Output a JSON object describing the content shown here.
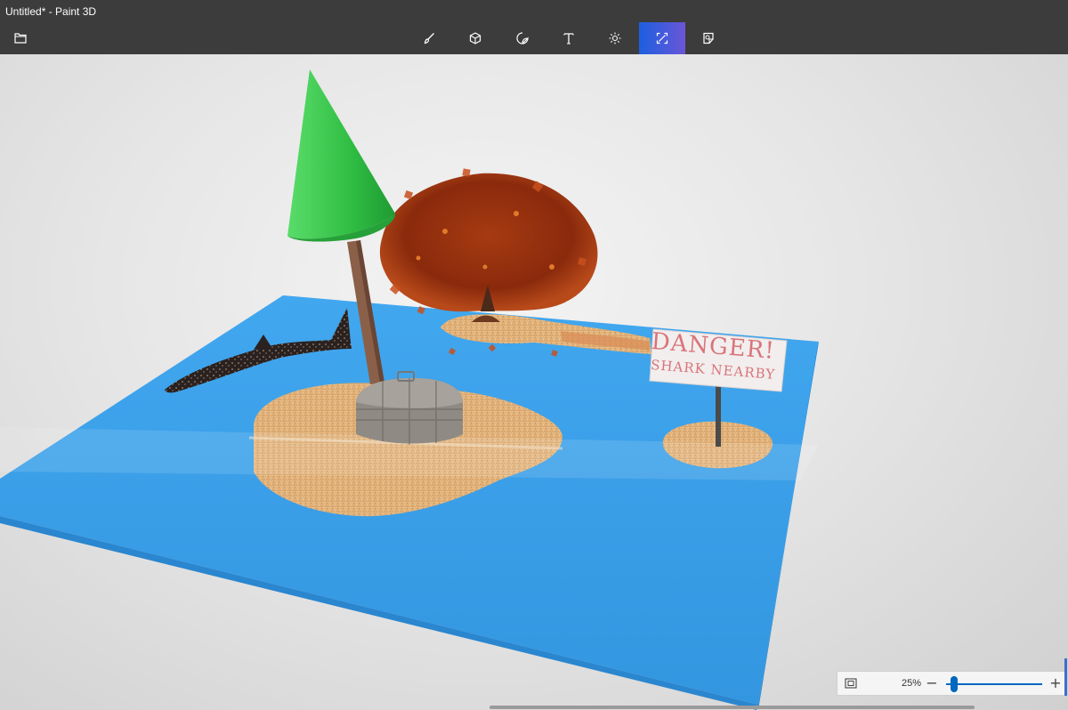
{
  "window": {
    "title": "Untitled* - Paint 3D"
  },
  "toolbar": {
    "menu_icon": "folder-icon",
    "tools": [
      {
        "name": "brushes",
        "icon": "brush-icon",
        "active": false
      },
      {
        "name": "3d-shapes",
        "icon": "cube-icon",
        "active": false
      },
      {
        "name": "stickers",
        "icon": "sticker-icon",
        "active": false
      },
      {
        "name": "text",
        "icon": "text-icon",
        "active": false
      },
      {
        "name": "effects",
        "icon": "sun-icon",
        "active": false
      },
      {
        "name": "canvas",
        "icon": "canvas-resize-icon",
        "active": true
      },
      {
        "name": "3d-library",
        "icon": "library-icon",
        "active": false
      }
    ],
    "accent_gradient": [
      "#1c5fe0",
      "#6a56d8"
    ]
  },
  "canvas": {
    "sign": {
      "line1": "DANGER!",
      "line2": "SHARK NEARBY"
    },
    "colors": {
      "water": "#3a9ee8",
      "sand": "#e2b07a",
      "cone": "#33c24a",
      "tree": "#8e2a10"
    }
  },
  "zoom": {
    "value": "25%",
    "minus": "−",
    "plus": "+",
    "level": 0.08
  }
}
